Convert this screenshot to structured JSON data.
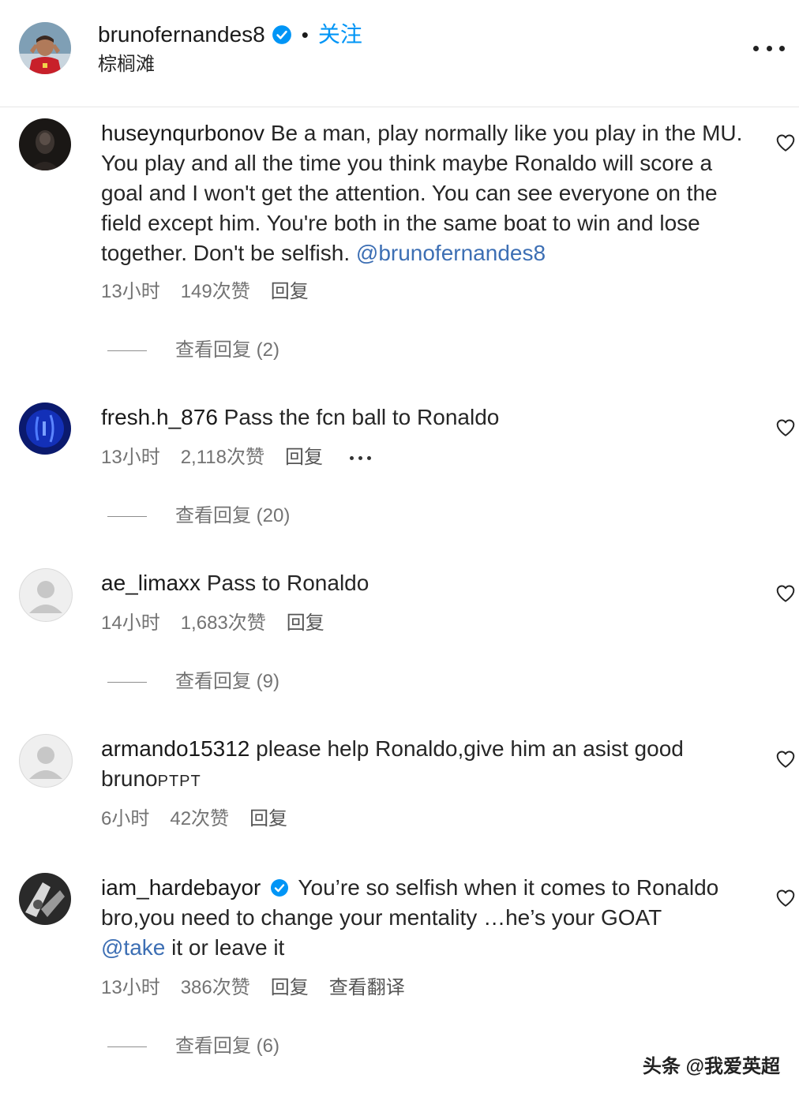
{
  "header": {
    "username": "brunofernandes8",
    "separator": "•",
    "follow_label": "关注",
    "location": "棕榈滩"
  },
  "comments": [
    {
      "username": "huseynqurbonov",
      "text": "Be a man, play normally like you play in the MU. You play and all the time you think maybe Ronaldo will score a goal and I won't get the attention. You can see everyone on the field except him. You're both in the same boat to win and lose together. Don't be selfish.",
      "mention": "@brunofernandes8",
      "time": "13小时",
      "likes": "149次赞",
      "reply_label": "回复",
      "view_replies": "查看回复 (2)"
    },
    {
      "username": "fresh.h_876",
      "text": "Pass the fcn ball to Ronaldo",
      "time": "13小时",
      "likes": "2,118次赞",
      "reply_label": "回复",
      "view_replies": "查看回复 (20)"
    },
    {
      "username": "ae_limaxx",
      "text": "Pass to Ronaldo",
      "time": "14小时",
      "likes": "1,683次赞",
      "reply_label": "回复",
      "view_replies": "查看回复 (9)"
    },
    {
      "username": "armando15312",
      "text": "please help Ronaldo,give him an asist good",
      "text_tail": "bruno",
      "text_tail_caps": "PTPT",
      "time": "6小时",
      "likes": "42次赞",
      "reply_label": "回复"
    },
    {
      "username": "iam_hardebayor",
      "text": "You’re so selfish when it comes to Ronaldo bro,you need to change your mentality …he’s your GOAT",
      "mention": "@take",
      "text_after_mention": "it or leave it",
      "time": "13小时",
      "likes": "386次赞",
      "reply_label": "回复",
      "translate_label": "查看翻译",
      "view_replies": "查看回复 (6)"
    }
  ],
  "watermark": "头条 @我爱英超",
  "colors": {
    "link_blue": "#0095f6",
    "mention_blue": "#3d6fb4",
    "muted_text": "#737373"
  },
  "icons": [
    "verified-badge-icon",
    "more-options-icon",
    "heart-icon",
    "default-avatar-icon"
  ]
}
